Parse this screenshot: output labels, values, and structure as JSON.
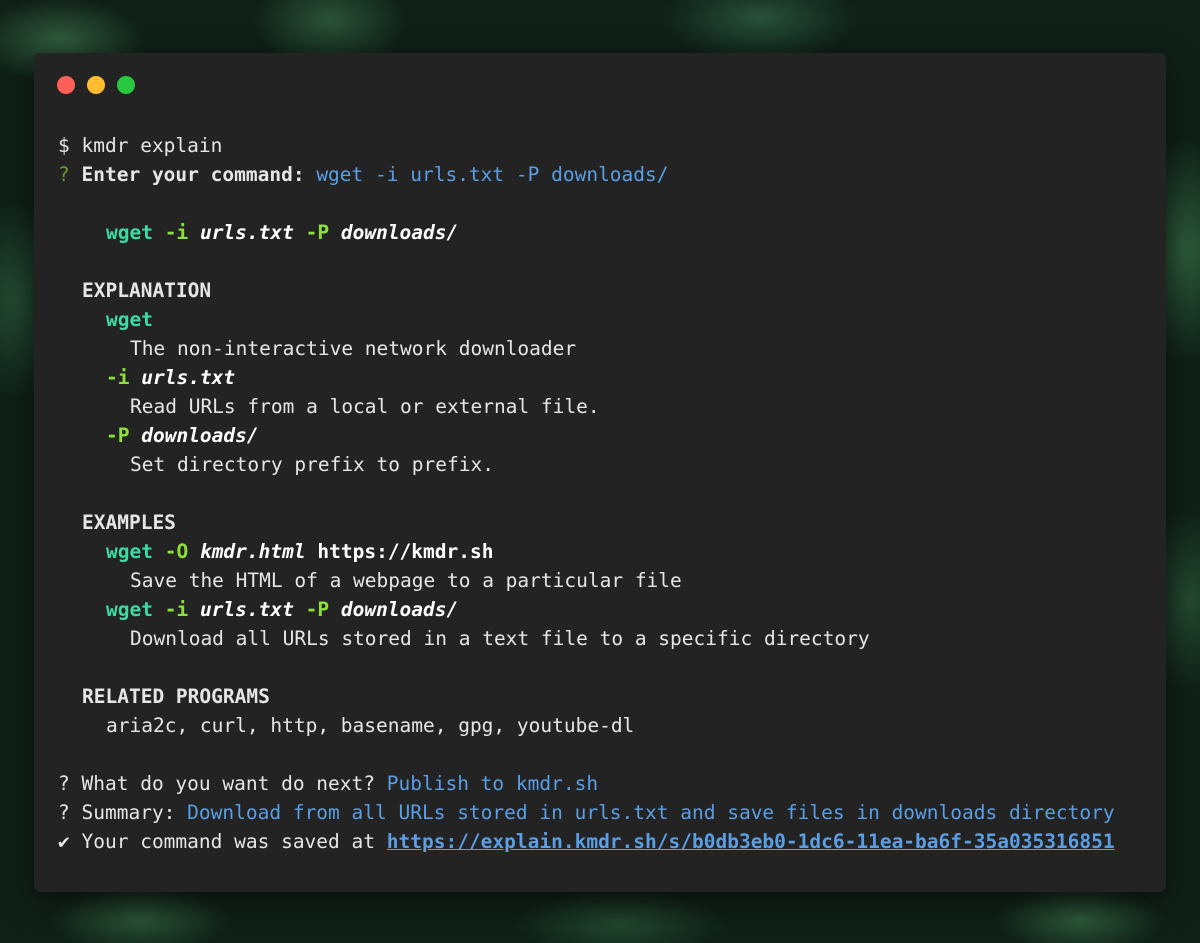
{
  "window": {
    "buttons": [
      "close",
      "minimize",
      "maximize"
    ]
  },
  "terminal": {
    "prompt_symbol": "$",
    "command": "kmdr explain",
    "enter_q_mark": "?",
    "enter_label": "Enter your command:",
    "enter_value": "wget -i urls.txt -P downloads/",
    "syntax": {
      "program": "wget",
      "opt1": "-i",
      "arg1": "urls.txt",
      "opt2": "-P",
      "arg2": "downloads/"
    },
    "explanation": {
      "heading": "EXPLANATION",
      "items": [
        {
          "flag": "wget",
          "arg": "",
          "desc": "The non-interactive network downloader"
        },
        {
          "flag": "-i",
          "arg": "urls.txt",
          "desc": "Read URLs from a local or external file."
        },
        {
          "flag": "-P",
          "arg": "downloads/",
          "desc": "Set directory prefix to prefix."
        }
      ]
    },
    "examples": {
      "heading": "EXAMPLES",
      "items": [
        {
          "program": "wget",
          "opt1": "-O",
          "arg1": "kmdr.html",
          "extra": "https://kmdr.sh",
          "desc": "Save the HTML of a webpage to a particular file"
        },
        {
          "program": "wget",
          "opt1": "-i",
          "arg1": "urls.txt",
          "opt2": "-P",
          "arg2": "downloads/",
          "desc": "Download all URLs stored in a text file to a specific directory"
        }
      ]
    },
    "related": {
      "heading": "RELATED PROGRAMS",
      "list": "aria2c, curl, http, basename, gpg, youtube-dl"
    },
    "next": {
      "q_mark": "?",
      "label": "What do you want do next?",
      "value": "Publish to kmdr.sh"
    },
    "summary": {
      "q_mark": "?",
      "label": "Summary:",
      "value": "Download from all URLs stored in urls.txt and save files in downloads directory"
    },
    "saved": {
      "check": "✔",
      "label": "Your command was saved at",
      "url": "https://explain.kmdr.sh/s/b0db3eb0-1dc6-11ea-ba6f-35a035316851"
    }
  },
  "colors": {
    "background": "#232323",
    "text": "#e6e6e6",
    "program": "#3ddba3",
    "option": "#8be13a",
    "link": "#5a9ee6"
  }
}
